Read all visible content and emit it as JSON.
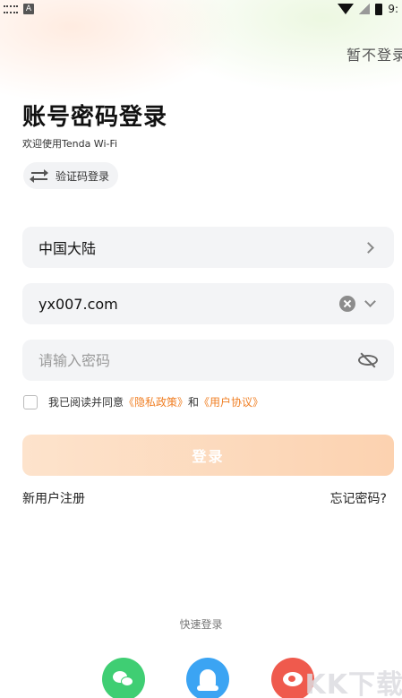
{
  "status_bar": {
    "time": "9:",
    "left_badge": "A"
  },
  "header": {
    "skip_label": "暂不登录"
  },
  "login": {
    "title": "账号密码登录",
    "subtitle": "欢迎使用Tenda Wi-Fi",
    "switch_label": "验证码登录"
  },
  "form": {
    "region_value": "中国大陆",
    "account_value": "yx007.com",
    "password_placeholder": "请输入密码",
    "agreement_prefix": "我已阅读并同意",
    "privacy_policy": "《隐私政策》",
    "agreement_and": "和",
    "user_agreement": "《用户协议》",
    "agreement_checked": false
  },
  "actions": {
    "login_label": "登录",
    "register_label": "新用户注册",
    "forgot_label": "忘记密码?"
  },
  "quick_login": {
    "title": "快速登录",
    "providers": [
      "wechat-icon",
      "qq-icon",
      "weibo-icon"
    ]
  },
  "watermark": {
    "text": "KK下载"
  },
  "colors": {
    "accent": "#f07f24",
    "login_button": "#fcd2b0",
    "field_bg": "#f3f4f6",
    "wechat": "#3fce73",
    "qq": "#3ba4f3",
    "weibo": "#ef5a4d"
  }
}
